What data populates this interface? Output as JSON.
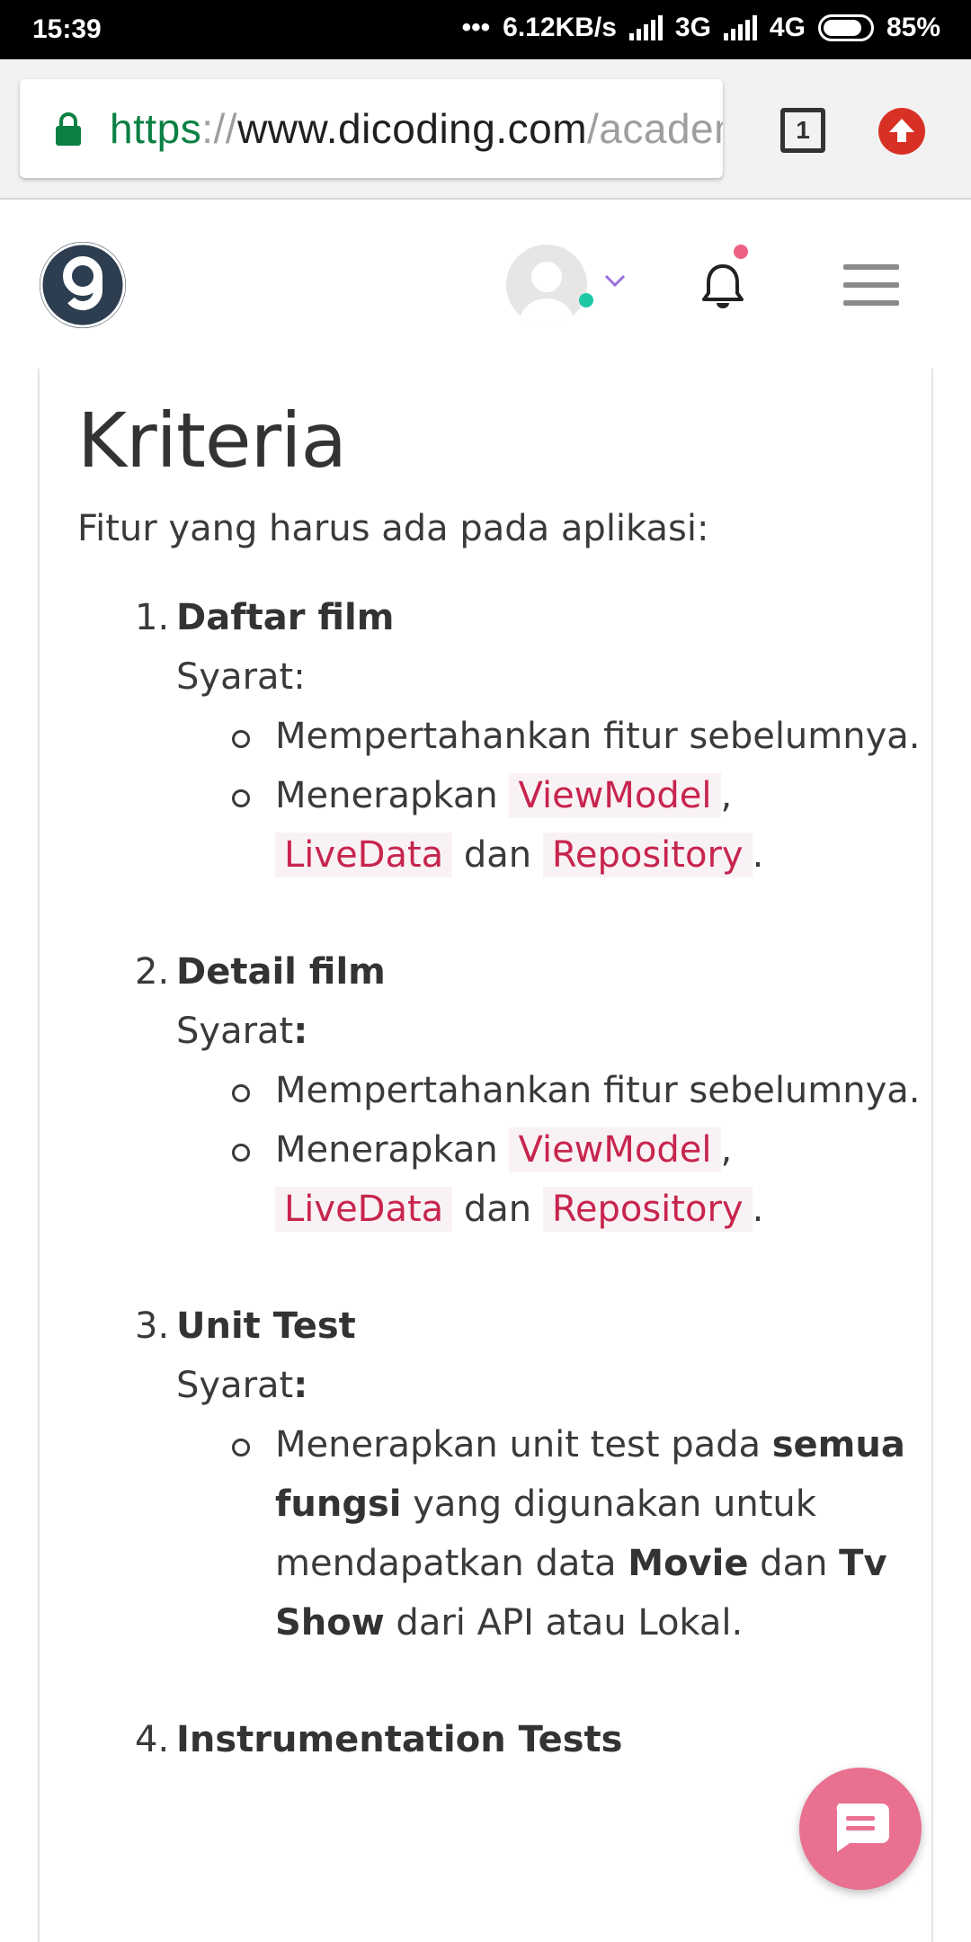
{
  "status_bar": {
    "time": "15:39",
    "dots": "•••",
    "speed": "6.12KB/s",
    "net1": "3G",
    "net2": "4G",
    "battery": "85%"
  },
  "browser": {
    "url_scheme": "https",
    "url_sep": "://",
    "url_host": "www.dicoding.com",
    "url_path": "/academ",
    "tab_count": "1"
  },
  "content": {
    "heading": "Kriteria",
    "intro": "Fitur yang harus ada pada aplikasi:",
    "items": [
      {
        "num": "1.",
        "title": "Daftar film",
        "syarat": "Syarat:",
        "b1": "Mempertahankan fitur sebelumnya.",
        "b2_pre": "Menerapkan ",
        "code1": "ViewModel",
        "comma": ",",
        "code2": "LiveData",
        "dan": " dan ",
        "code3": "Repository",
        "period": "."
      },
      {
        "num": "2.",
        "title": "Detail film",
        "syarat": "Syarat",
        "colon": ":",
        "b1": "Mempertahankan fitur sebelumnya.",
        "b2_pre": "Menerapkan ",
        "code1": "ViewModel",
        "comma": ",",
        "code2": "LiveData",
        "dan": " dan ",
        "code3": "Repository",
        "period": "."
      },
      {
        "num": "3.",
        "title": "Unit Test",
        "syarat": "Syarat",
        "colon": ":",
        "t1": "Menerapkan unit test pada ",
        "t2": "semua fungsi",
        "t3": " yang digunakan untuk mendapatkan data ",
        "t4": "Movie",
        "t5": " dan ",
        "t6": "Tv Show",
        "t7": " dari API atau Lokal."
      },
      {
        "num": "4.",
        "title": "Instrumentation Tests"
      }
    ]
  },
  "colors": {
    "code": "#c7254e",
    "code_bg": "#f9f2f4",
    "chat_button": "#e9708f",
    "logo": "#2d3e50"
  }
}
